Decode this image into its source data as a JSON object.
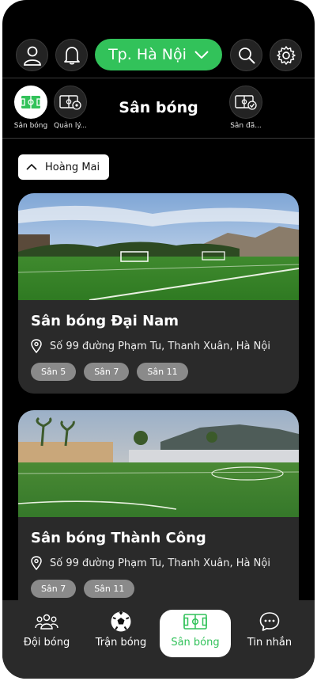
{
  "header": {
    "city": "Tp. Hà Nội"
  },
  "categories": [
    {
      "label": "Sân bóng"
    },
    {
      "label": "Quản lý..."
    },
    {
      "label": "Sân đã..."
    }
  ],
  "page_title": "Sân bóng",
  "filter": {
    "district": "Hoàng Mai"
  },
  "fields": [
    {
      "name": "Sân bóng Đại Nam",
      "address": "Số 99 đường Phạm Tu, Thanh Xuân, Hà Nội",
      "tags": [
        "Sân 5",
        "Sân 7",
        "Sân 11"
      ]
    },
    {
      "name": "Sân bóng Thành Công",
      "address": "Số 99 đường Phạm Tu, Thanh Xuân, Hà Nội",
      "tags": [
        "Sân 7",
        "Sân 11"
      ]
    }
  ],
  "bottom_nav": [
    {
      "label": "Đội bóng",
      "icon": "team-icon"
    },
    {
      "label": "Trận bóng",
      "icon": "football-icon"
    },
    {
      "label": "Sân bóng",
      "icon": "field-icon",
      "active": true
    },
    {
      "label": "Tin nhắn",
      "icon": "chat-icon"
    }
  ],
  "colors": {
    "accent": "#32c25a",
    "background": "#000000",
    "card": "#2a2a2a"
  }
}
